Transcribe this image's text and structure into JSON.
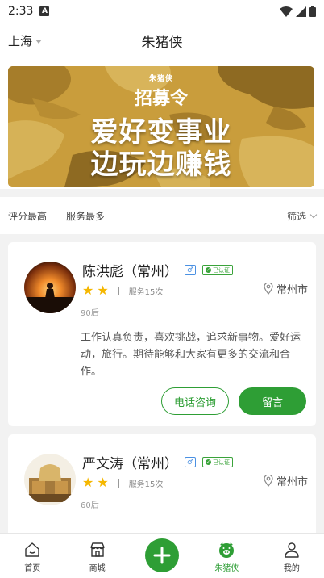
{
  "status_bar": {
    "time": "2:33"
  },
  "nav": {
    "city": "上海",
    "title": "朱猪侠"
  },
  "banner": {
    "small_text": "朱猪侠",
    "subtitle": "招募令",
    "line1": "爱好变事业",
    "line2": "边玩边赚钱"
  },
  "filters": {
    "items": [
      "评分最高",
      "服务最多"
    ],
    "right": "筛选"
  },
  "providers": [
    {
      "name": "陈洪彪（常州）",
      "gender": "♂",
      "verified": "已认证",
      "stars": 2,
      "service": "服务15次",
      "age": "90后",
      "location": "常州市",
      "bio": "工作认真负责，喜欢挑战，追求新事物。爱好运动，旅行。期待能够和大家有更多的交流和合作。",
      "call_label": "电话咨询",
      "message_label": "留言"
    },
    {
      "name": "严文涛（常州）",
      "gender": "♂",
      "verified": "已认证",
      "stars": 2,
      "service": "服务15次",
      "age": "60后",
      "location": "常州市"
    }
  ],
  "tabs": [
    {
      "label": "首页",
      "icon": "home-icon"
    },
    {
      "label": "商城",
      "icon": "shop-icon"
    },
    {
      "label": "",
      "icon": "plus-icon"
    },
    {
      "label": "朱猪侠",
      "icon": "pig-icon"
    },
    {
      "label": "我的",
      "icon": "user-icon"
    }
  ],
  "colors": {
    "accent": "#2e9e35",
    "star": "#f5b700",
    "banner": "#c49a3a"
  }
}
